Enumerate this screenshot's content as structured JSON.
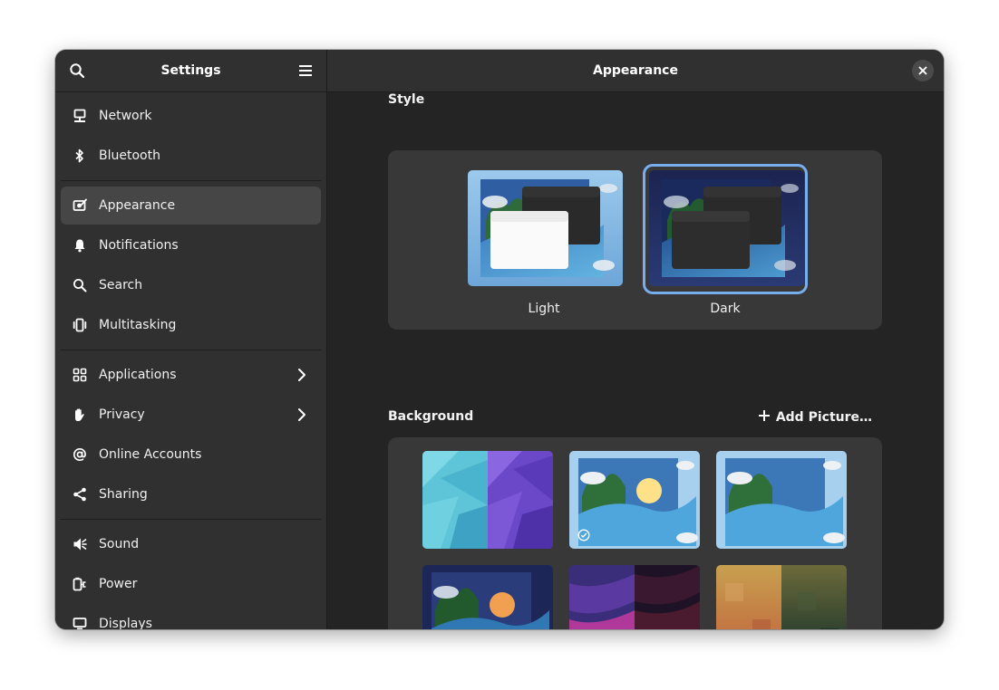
{
  "sidebar": {
    "title": "Settings",
    "search_icon": "search-icon",
    "menu_icon": "hamburger-menu-icon",
    "groups": [
      [
        {
          "label": "Network",
          "icon": "network-icon"
        },
        {
          "label": "Bluetooth",
          "icon": "bluetooth-icon"
        }
      ],
      [
        {
          "label": "Appearance",
          "icon": "appearance-icon",
          "active": true
        },
        {
          "label": "Notifications",
          "icon": "bell-icon"
        },
        {
          "label": "Search",
          "icon": "search-icon"
        },
        {
          "label": "Multitasking",
          "icon": "multitasking-icon"
        }
      ],
      [
        {
          "label": "Applications",
          "icon": "apps-grid-icon",
          "chevron": true
        },
        {
          "label": "Privacy",
          "icon": "hand-icon",
          "chevron": true
        },
        {
          "label": "Online Accounts",
          "icon": "at-sign-icon"
        },
        {
          "label": "Sharing",
          "icon": "share-icon"
        }
      ],
      [
        {
          "label": "Sound",
          "icon": "speaker-icon"
        },
        {
          "label": "Power",
          "icon": "power-plug-icon"
        },
        {
          "label": "Displays",
          "icon": "display-icon"
        }
      ]
    ]
  },
  "header": {
    "title": "Appearance",
    "close_icon": "close-icon"
  },
  "style": {
    "title": "Style",
    "options": [
      {
        "label": "Light",
        "selected": false
      },
      {
        "label": "Dark",
        "selected": true
      }
    ]
  },
  "background": {
    "title": "Background",
    "add_label": "Add Picture…",
    "wallpapers": [
      {
        "name": "triangles-blue-purple",
        "selected": false
      },
      {
        "name": "fold-day",
        "selected": true
      },
      {
        "name": "fold-day-alt",
        "selected": false
      },
      {
        "name": "fold-night",
        "selected": false
      },
      {
        "name": "waves-purple",
        "selected": false
      },
      {
        "name": "pixels-amber",
        "selected": false
      }
    ]
  },
  "colors": {
    "accent": "#78aeed",
    "sidebar_bg": "#303030",
    "content_bg": "#242424",
    "card_bg": "#383838",
    "active_row": "#464646"
  }
}
